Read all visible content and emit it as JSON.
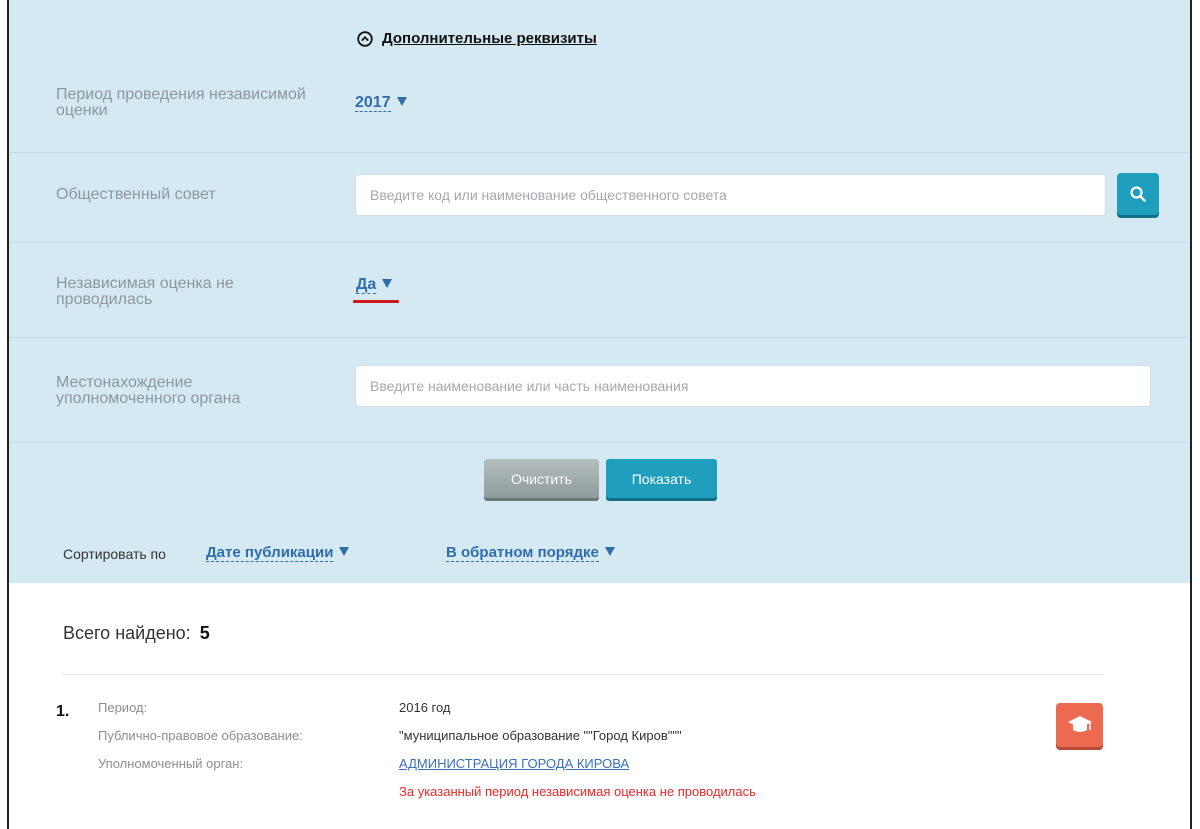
{
  "filters": {
    "toggle_label": "Дополнительные реквизиты",
    "period_label": "Период проведения независимой оценки",
    "period_value": "2017",
    "council_label": "Общественный совет",
    "council_placeholder": "Введите код или наименование общественного совета",
    "not_held_label": "Независимая оценка не проводилась",
    "not_held_value": "Да",
    "location_label": "Местонахождение уполномоченного органа",
    "location_placeholder": "Введите наименование или часть наименования",
    "clear_label": "Очистить",
    "show_label": "Показать"
  },
  "sort": {
    "label": "Сортировать по",
    "field_value": "Дате публикации",
    "order_value": "В обратном порядке"
  },
  "results": {
    "total_label": "Всего найдено:",
    "total_count": "5",
    "items": [
      {
        "number": "1.",
        "period_label": "Период:",
        "period_value": "2016 год",
        "entity_label": "Публично-правовое образование:",
        "entity_value": "\"муниципальное образование \"\"Город Киров\"\"\"",
        "authority_label": "Уполномоченный орган:",
        "authority_value": "АДМИНИСТРАЦИЯ ГОРОДА КИРОВА",
        "note": "За указанный период независимая оценка не проводилась"
      }
    ]
  },
  "colors": {
    "panel_bg": "#d5e9f3",
    "accent": "#1f9fbd",
    "link": "#2f6ea8",
    "warning": "#e52a2a",
    "badge": "#ec6a50"
  },
  "icons": {
    "toggle": "chevron-up-circle-icon",
    "search": "search-icon",
    "badge": "graduation-cap-icon"
  }
}
